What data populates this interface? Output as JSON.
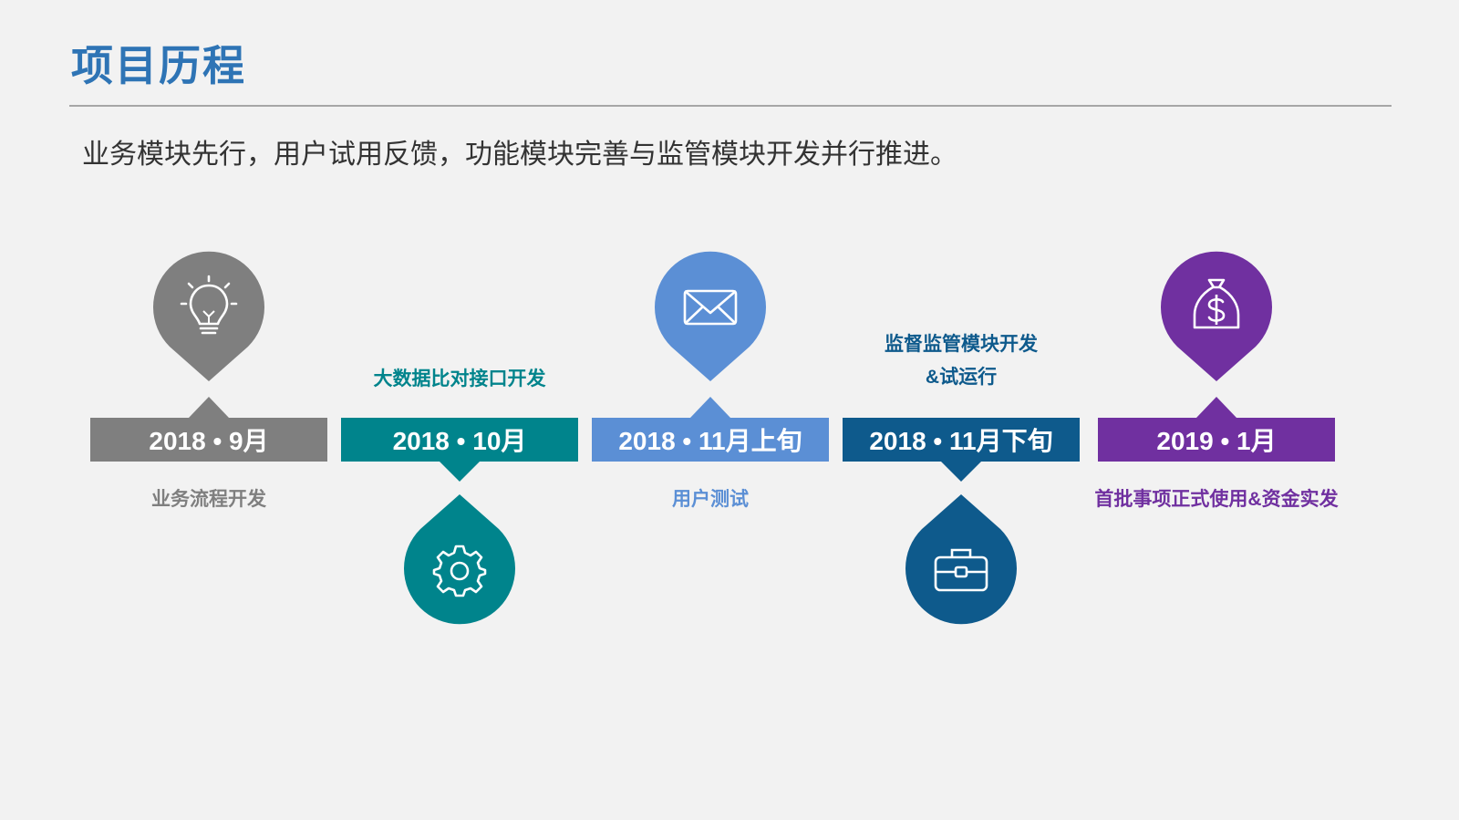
{
  "title": "项目历程",
  "subtitle": "业务模块先行，用户试用反馈，功能模块完善与监管模块开发并行推进。",
  "milestones": [
    {
      "date": "2018 • 9月",
      "label": "业务流程开发",
      "label_line2": "",
      "color": "#7f7f7f",
      "icon": "lightbulb-icon",
      "position": "above"
    },
    {
      "date": "2018 • 10月",
      "label": "大数据比对接口开发",
      "label_line2": "",
      "color": "#00848c",
      "icon": "gear-icon",
      "position": "below"
    },
    {
      "date": "2018 • 11月上旬",
      "label": "用户测试",
      "label_line2": "",
      "color": "#5b8fd5",
      "icon": "envelope-icon",
      "position": "above"
    },
    {
      "date": "2018 • 11月下旬",
      "label": "监督监管模块开发",
      "label_line2": "&试运行",
      "color": "#0e5a8c",
      "icon": "briefcase-icon",
      "position": "below"
    },
    {
      "date": "2019 • 1月",
      "label": "首批事项正式使用&资金实发",
      "label_line2": "",
      "color": "#7030a0",
      "icon": "money-bag-icon",
      "position": "above"
    }
  ]
}
